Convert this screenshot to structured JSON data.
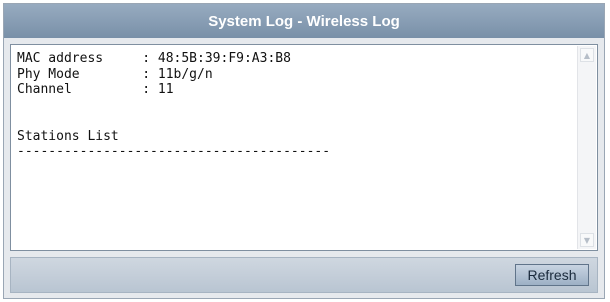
{
  "window": {
    "title": "System Log - Wireless Log"
  },
  "log": {
    "content": "MAC address     : 48:5B:39:F9:A3:B8\nPhy Mode        : 11b/g/n\nChannel         : 11\n\n\nStations List\n----------------------------------------"
  },
  "scrollbar": {
    "up_icon": "chevron-up-icon",
    "down_icon": "chevron-down-icon"
  },
  "footer": {
    "refresh_label": "Refresh"
  }
}
